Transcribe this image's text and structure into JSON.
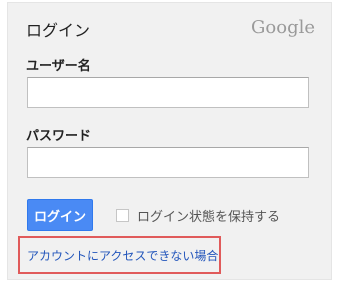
{
  "header": {
    "title": "ログイン",
    "brand": "Google"
  },
  "form": {
    "username_label": "ユーザー名",
    "username_value": "",
    "password_label": "パスワード",
    "password_value": "",
    "login_button": "ログイン",
    "remember_label": "ログイン状態を保持する",
    "remember_checked": false,
    "help_link": "アカウントにアクセスできない場合"
  },
  "colors": {
    "primary_button": "#4a8af4",
    "link": "#2255bb",
    "highlight_border": "#e05a5a",
    "panel_bg": "#f1f1f1"
  }
}
